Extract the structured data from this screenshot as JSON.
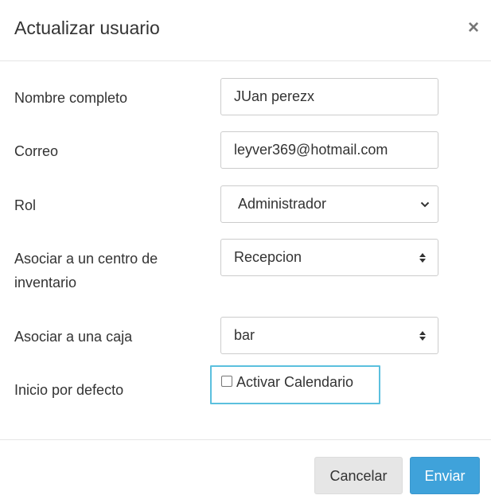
{
  "dialog": {
    "title": "Actualizar usuario",
    "close_symbol": "×"
  },
  "form": {
    "nombre": {
      "label": "Nombre completo",
      "value": "JUan perezx"
    },
    "correo": {
      "label": "Correo",
      "value": "leyver369@hotmail.com"
    },
    "rol": {
      "label": "Rol",
      "selected": "Administrador",
      "icon": "chevron-down-icon"
    },
    "centro": {
      "label_line1": "Asociar a un centro de",
      "label_line2": "inventario",
      "selected": "Recepcion",
      "icon": "sort-updown-icon"
    },
    "caja": {
      "label": "Asociar a una caja",
      "selected": "bar",
      "icon": "sort-updown-icon"
    },
    "inicio": {
      "label": "Inicio por defecto",
      "checkbox_label": "Activar Calendario",
      "checked": false
    }
  },
  "footer": {
    "cancel_label": "Cancelar",
    "submit_label": "Enviar"
  },
  "colors": {
    "primary": "#3fa2da",
    "focus_border": "#5bc0de",
    "cancel_bg": "#e6e6e6"
  }
}
